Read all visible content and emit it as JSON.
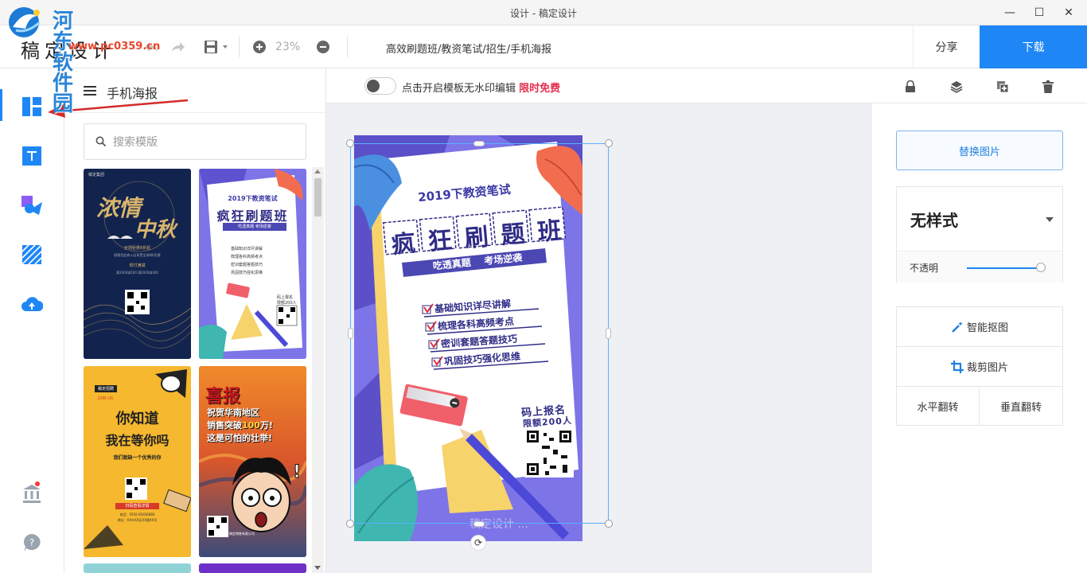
{
  "window": {
    "title": "设计 - 稿定设计",
    "min_glyph": "—",
    "max_glyph": "☐",
    "close_glyph": "✕"
  },
  "watermark": {
    "name": "河东软件园",
    "url": "www.pc0359.cn"
  },
  "toolbar": {
    "brand": "稿定设计",
    "zoom": "23%",
    "tags": "高效刷题班/教资笔试/招生/手机海报",
    "share_label": "分享",
    "download_label": "下载"
  },
  "rail": {
    "items": [
      {
        "name": "template-icon"
      },
      {
        "name": "text-icon"
      },
      {
        "name": "element-icon"
      },
      {
        "name": "background-icon"
      },
      {
        "name": "upload-icon"
      },
      {
        "name": "brand-library-icon"
      },
      {
        "name": "help-icon"
      }
    ],
    "accent": "#1f87f5"
  },
  "panel": {
    "title": "手机海报",
    "search_placeholder": "搜索模版",
    "thumbs": [
      {
        "id": "t1",
        "corner": "稿定集团",
        "line1": "浓情",
        "line2": "中秋",
        "info1": "全场钜惠8折起",
        "info2": "顾客凭此券入店享受全场8折优惠",
        "info3": "现付满减",
        "info4": "满1000减100 满2000减300",
        "bg": "#12244e"
      },
      {
        "id": "t2",
        "year": "2019下教资笔试",
        "headline": "疯狂刷题班",
        "sub": "吃透真题  考场逆袭",
        "items": [
          "基础知识详尽讲解",
          "梳理各科高频考点",
          "密训套题答题技巧",
          "巩固技巧强化思维"
        ],
        "cta": "码上报名",
        "cta2": "限额200人",
        "bg": "#7d74e8"
      },
      {
        "id": "t3",
        "tag": "稿定招聘",
        "tag2": "JOIN US",
        "line1": "你知道",
        "line2": "我在等你吗",
        "line3": "我们就缺一个优秀的你",
        "cta": "扫码查看详情",
        "contact": "电话：0592-85656866",
        "address": "地址：XX市XX区XX路XX号",
        "bg": "#f5b82e"
      },
      {
        "id": "t4",
        "headline": "喜报",
        "line1": "祝贺华南地区",
        "line2a": "销售突破",
        "line2b": "100",
        "line2c": "万!",
        "line3": "这是可怕的壮举!",
        "corner": "稿定销售有限公司",
        "bg": "#d9562b"
      }
    ]
  },
  "canvas_bar": {
    "toggle_text": "点击开启模板无水印编辑",
    "free_tag": "限时免费"
  },
  "poster": {
    "year": "2019下教资笔试",
    "headline_chars": [
      "疯",
      "狂",
      "刷",
      "题",
      "班"
    ],
    "banner": "吃透真题    考场逆袭",
    "checklist": [
      "基础知识详尽讲解",
      "梳理各科高频考点",
      "密训套题答题技巧",
      "巩固技巧强化思维"
    ],
    "cta1": "码上报名",
    "cta2": "限额200人",
    "footer": "稿定设计 ...",
    "rotate_glyph": "⟳"
  },
  "props": {
    "replace_label": "替换图片",
    "style_name": "无样式",
    "opacity_label": "不透明",
    "opacity_value": 1.0,
    "smart_cutout_label": "智能抠图",
    "crop_label": "裁剪图片",
    "flip_h_label": "水平翻转",
    "flip_v_label": "垂直翻转"
  }
}
